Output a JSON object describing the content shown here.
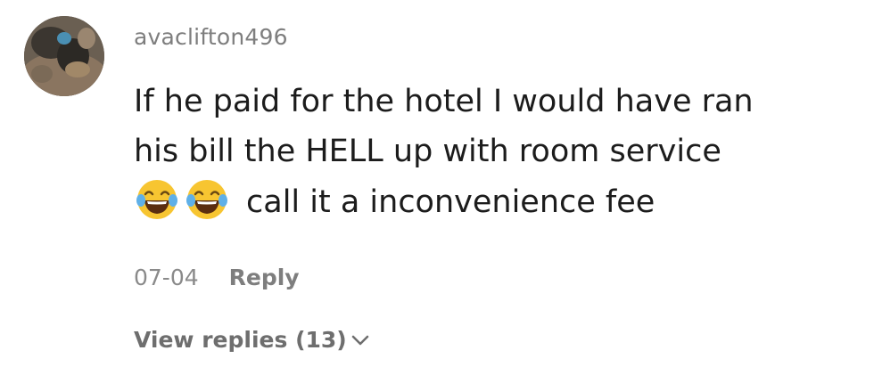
{
  "comment": {
    "username": "avaclifton496",
    "text_line1": "If he paid for the hotel I would have ran",
    "text_line2": "his bill the HELL up with room service",
    "text_line3": "call it a inconvenience fee",
    "emojis": [
      "face-with-tears-of-joy",
      "face-with-tears-of-joy"
    ],
    "date": "07-04",
    "reply_label": "Reply",
    "view_replies_label": "View replies (13)",
    "view_replies_icon": "chevron-down-icon"
  },
  "colors": {
    "username": "#7e7e7e",
    "text": "#1c1c1c",
    "meta": "#8a8a8a",
    "emoji_face": "#f7c531"
  }
}
